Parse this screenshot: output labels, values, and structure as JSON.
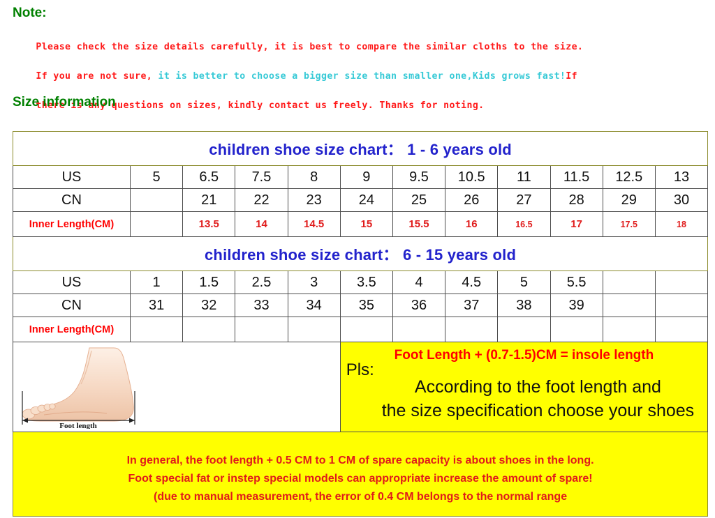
{
  "note": {
    "title": "Note:",
    "line1": "Please check the size details carefully, it is best to compare the similar cloths to the size.",
    "line2_red_a": "If you are not sure, ",
    "line2_cyan": "it is better to choose a bigger size than smaller one,Kids grows fast!",
    "line2_red_b": "If",
    "line3": "there is any questions on sizes, kindly contact us freely. Thanks for noting."
  },
  "size_information_heading": "Size information",
  "table1": {
    "title": "children  shoe size chart：  1 - 6 years old",
    "rows": [
      {
        "label": "US",
        "values": [
          "5",
          "6.5",
          "7.5",
          "8",
          "9",
          "9.5",
          "10.5",
          "11",
          "11.5",
          "12.5",
          "13"
        ]
      },
      {
        "label": "CN",
        "values": [
          "",
          "21",
          "22",
          "23",
          "24",
          "25",
          "26",
          "27",
          "28",
          "29",
          "30"
        ]
      },
      {
        "label": "Inner Length(CM)",
        "values": [
          "",
          "13.5",
          "14",
          "14.5",
          "15",
          "15.5",
          "16",
          "16.5",
          "17",
          "17.5",
          "18"
        ]
      }
    ]
  },
  "table2": {
    "title": "children  shoe size chart：  6 - 15 years old",
    "rows": [
      {
        "label": "US",
        "values": [
          "1",
          "1.5",
          "2.5",
          "3",
          "3.5",
          "4",
          "4.5",
          "5",
          "5.5",
          "",
          ""
        ]
      },
      {
        "label": "CN",
        "values": [
          "31",
          "32",
          "33",
          "34",
          "35",
          "36",
          "37",
          "38",
          "39",
          "",
          ""
        ]
      },
      {
        "label": "Inner Length(CM)",
        "values": [
          "",
          "",
          "",
          "",
          "",
          "",
          "",
          "",
          "",
          "",
          ""
        ]
      }
    ]
  },
  "foot_diagram": {
    "caption": "Foot length"
  },
  "pls_panel": {
    "pls_label": "Pls:",
    "formula": "Foot Length + (0.7-1.5)CM = insole length",
    "line1": "According to the foot length and",
    "line2": "the size specification choose your shoes"
  },
  "footer_notes": {
    "line1": "In general, the foot length + 0.5 CM to 1 CM of spare capacity is about shoes in the long.",
    "line2": "Foot special fat or instep special models can appropriate increase the amount of spare!",
    "line3": "(due to manual measurement, the error of 0.4 CM belongs to the normal range"
  },
  "colors": {
    "highlight_yellow": "#ffff00",
    "title_blue": "#2222cc",
    "note_red": "#ff1a1a",
    "note_cyan": "#35c9d6",
    "heading_green": "#008000",
    "inner_length_red": "#e01b1b"
  }
}
